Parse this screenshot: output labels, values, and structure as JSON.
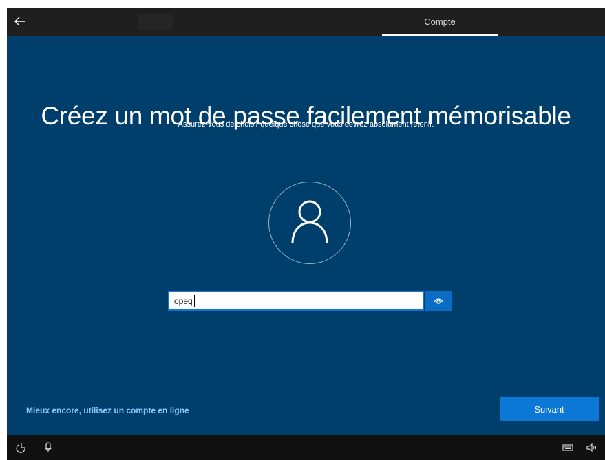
{
  "header": {
    "back_icon": "arrow-left-icon",
    "tab_label": "Compte"
  },
  "main": {
    "title": "Créez un mot de passe facilement mémorisable",
    "subtitle": "Assurez-vous de choisir quelque chose que vous devrez absolument retenir.",
    "avatar_icon": "user-icon",
    "password": {
      "value": "opeq",
      "reveal_icon": "eye-icon"
    },
    "online_account_link": "Mieux encore, utilisez un compte en ligne",
    "next_button": "Suivant"
  },
  "taskbar": {
    "icons_left": [
      "accessibility-icon",
      "microphone-icon"
    ],
    "icons_right": [
      "keyboard-icon",
      "volume-icon"
    ]
  },
  "colors": {
    "background": "#003e6b",
    "topbar": "#1f1f1f",
    "accent": "#0a78d4",
    "link": "#85c7ff"
  }
}
